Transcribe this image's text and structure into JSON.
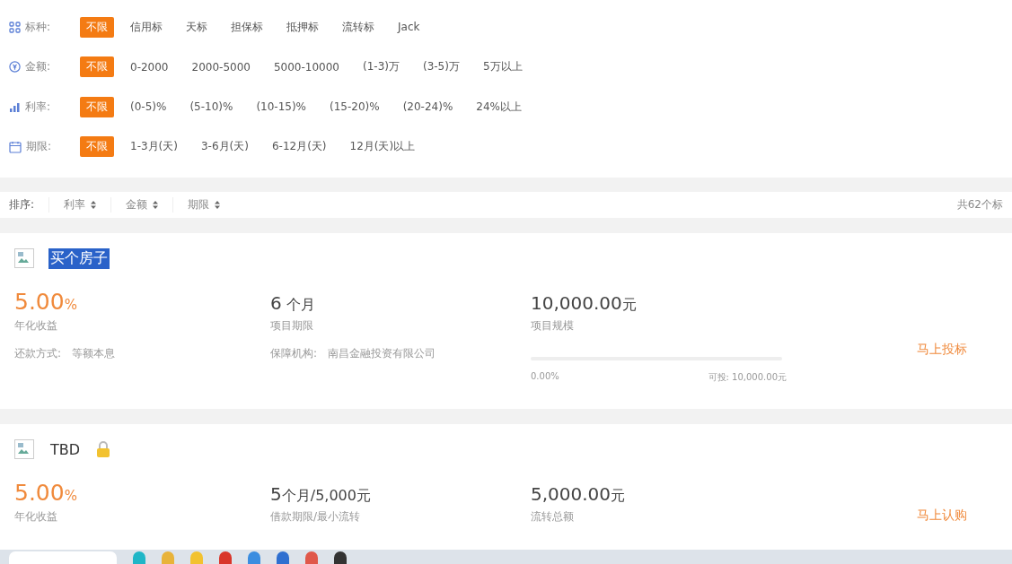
{
  "filters": [
    {
      "kind": "type",
      "label": "标种:",
      "options": [
        {
          "label": "不限",
          "selected": true
        },
        {
          "label": "信用标",
          "selected": false
        },
        {
          "label": "天标",
          "selected": false
        },
        {
          "label": "担保标",
          "selected": false
        },
        {
          "label": "抵押标",
          "selected": false
        },
        {
          "label": "流转标",
          "selected": false
        },
        {
          "label": "Jack",
          "selected": false
        }
      ]
    },
    {
      "kind": "amount",
      "label": "金额:",
      "options": [
        {
          "label": "不限",
          "selected": true
        },
        {
          "label": "0-2000",
          "selected": false
        },
        {
          "label": "2000-5000",
          "selected": false
        },
        {
          "label": "5000-10000",
          "selected": false
        },
        {
          "label": "(1-3)万",
          "selected": false
        },
        {
          "label": "(3-5)万",
          "selected": false
        },
        {
          "label": "5万以上",
          "selected": false
        }
      ]
    },
    {
      "kind": "rate",
      "label": "利率:",
      "options": [
        {
          "label": "不限",
          "selected": true
        },
        {
          "label": "(0-5)%",
          "selected": false
        },
        {
          "label": "(5-10)%",
          "selected": false
        },
        {
          "label": "(10-15)%",
          "selected": false
        },
        {
          "label": "(15-20)%",
          "selected": false
        },
        {
          "label": "(20-24)%",
          "selected": false
        },
        {
          "label": "24%以上",
          "selected": false
        }
      ]
    },
    {
      "kind": "term",
      "label": "期限:",
      "options": [
        {
          "label": "不限",
          "selected": true
        },
        {
          "label": "1-3月(天)",
          "selected": false
        },
        {
          "label": "3-6月(天)",
          "selected": false
        },
        {
          "label": "6-12月(天)",
          "selected": false
        },
        {
          "label": "12月(天)以上",
          "selected": false
        }
      ]
    }
  ],
  "sort": {
    "label": "排序:",
    "items": [
      {
        "label": "利率"
      },
      {
        "label": "金额"
      },
      {
        "label": "期限"
      }
    ],
    "total": "共62个标"
  },
  "projects": [
    {
      "title": "买个房子",
      "selected": true,
      "locked": false,
      "rate": "5.00",
      "rate_unit": "%",
      "rate_label": "年化收益",
      "term": "6",
      "term_unit": " 个月",
      "term_label": "项目期限",
      "amount": "10,000.00",
      "amount_unit": "元",
      "amount_label": "项目规模",
      "repay_label": "还款方式:",
      "repay_value": "等额本息",
      "guarantee_label": "保障机构:",
      "guarantee_value": "南昌金融投资有限公司",
      "progress": {
        "level": 0,
        "percent": "0.00%",
        "available": "可投: 10,000.00元"
      },
      "action": "马上投标"
    },
    {
      "title": "TBD",
      "selected": false,
      "locked": true,
      "rate": "5.00",
      "rate_unit": "%",
      "rate_label": "年化收益",
      "term": "5",
      "term_unit": "个月/5,000元",
      "term_label": "借款期限/最小流转",
      "amount": "5,000.00",
      "amount_unit": "元",
      "amount_label": "流转总额",
      "action": "马上认购"
    }
  ]
}
